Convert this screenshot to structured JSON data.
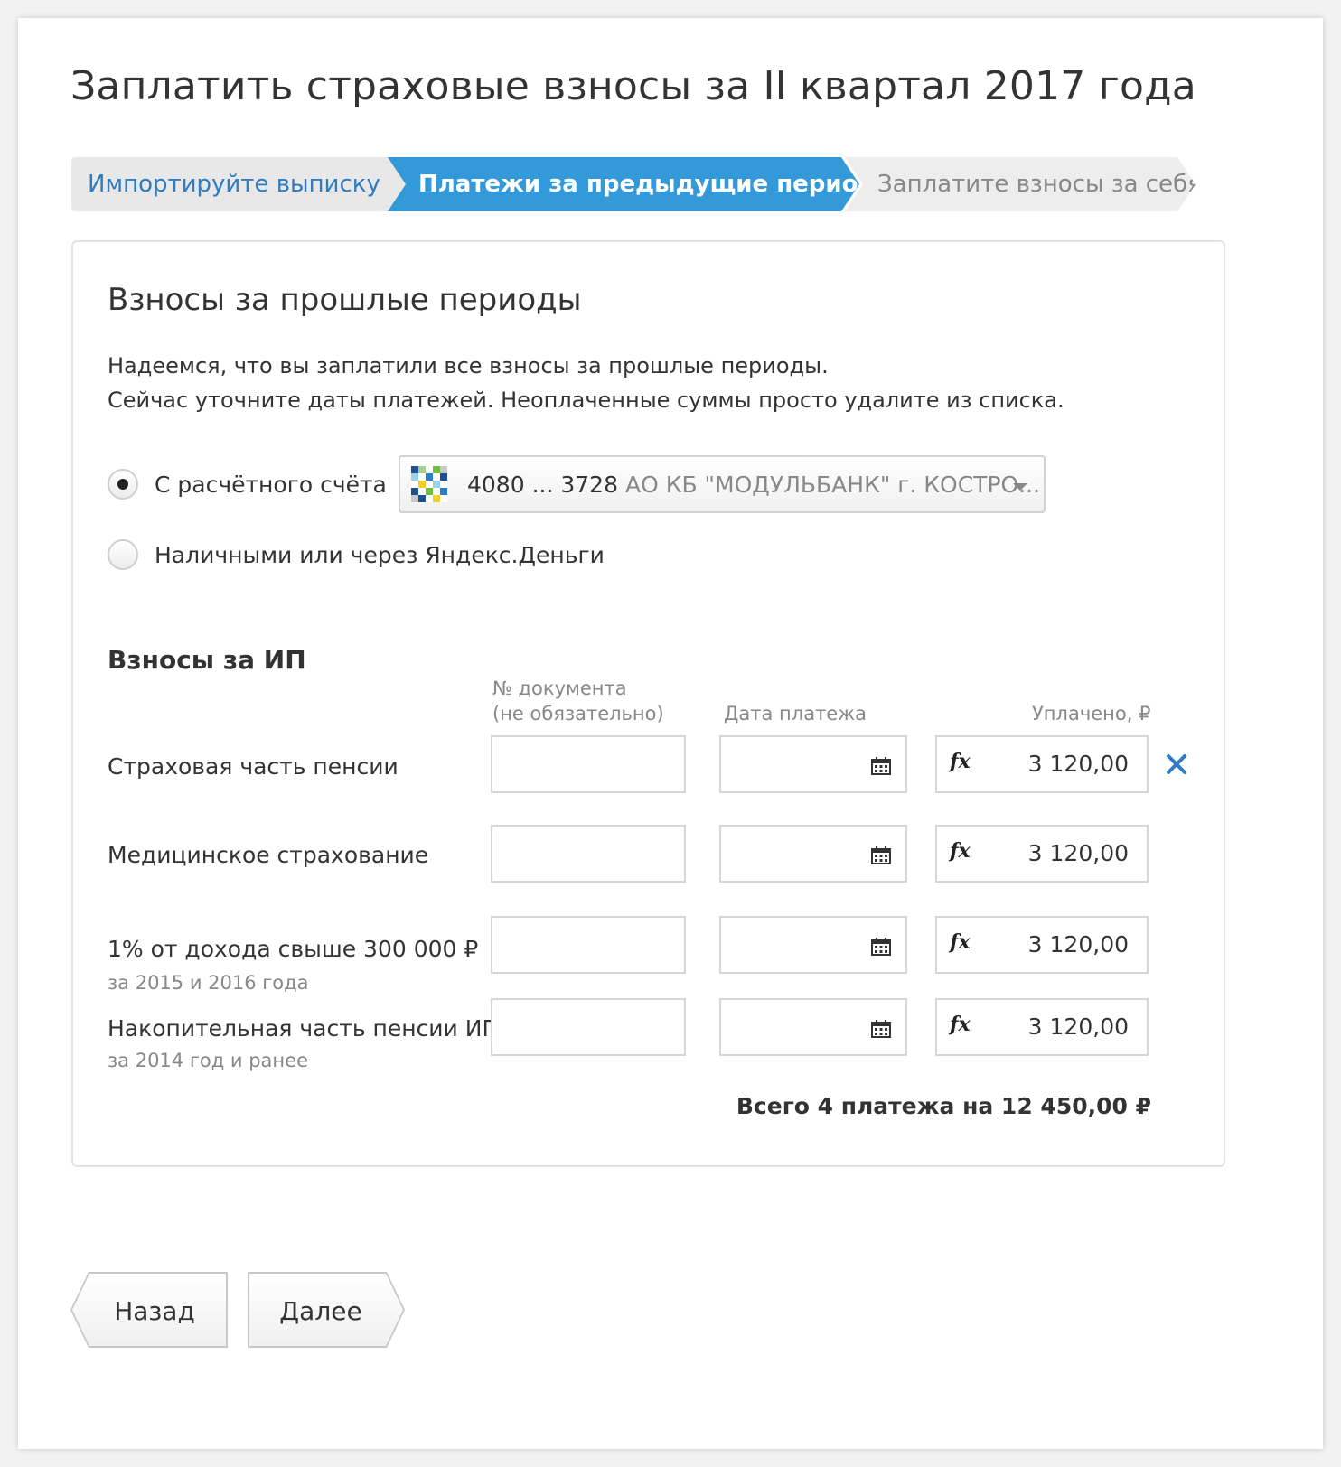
{
  "page": {
    "title": "Заплатить страховые взносы за II квартал 2017 года"
  },
  "stepper": {
    "steps": [
      {
        "label": "Импортируйте выписку",
        "state": "done"
      },
      {
        "label": "Платежи за предыдущие периоды",
        "state": "active"
      },
      {
        "label": "Заплатите взносы за себя",
        "state": "pending"
      }
    ]
  },
  "card": {
    "title": "Взносы за прошлые периоды",
    "description": [
      "Надеемся, что вы заплатили все взносы за прошлые периоды.",
      "Сейчас уточните даты платежей. Неоплаченные суммы просто удалите из списка."
    ],
    "payment_source": {
      "options": [
        {
          "label": "С расчётного счёта",
          "checked": true
        },
        {
          "label": "Наличными или через Яндекс.Деньги",
          "checked": false
        }
      ],
      "account": {
        "number": "4080 ... 3728",
        "bank": "АО КБ \"МОДУЛЬБАНК\" г. КОСТРО..."
      }
    },
    "contributions": {
      "title": "Взносы за ИП",
      "columns": {
        "doc_line1": "№ документа",
        "doc_line2": "(не обязательно)",
        "date": "Дата платежа",
        "paid": "Уплачено, ₽"
      },
      "rows": [
        {
          "label": "Страховая часть пенсии",
          "sublabel": "",
          "doc": "",
          "date": "",
          "sum": "3 120,00",
          "removable": true
        },
        {
          "label": "Медицинское страхование",
          "sublabel": "",
          "doc": "",
          "date": "",
          "sum": "3 120,00",
          "removable": false
        },
        {
          "label": "1% от дохода свыше 300 000 ₽",
          "sublabel": "за 2015 и 2016 года",
          "doc": "",
          "date": "",
          "sum": "3 120,00",
          "removable": false
        },
        {
          "label": "Накопительная часть пенсии ИП",
          "sublabel": "за 2014 год и ранее",
          "doc": "",
          "date": "",
          "sum": "3 120,00",
          "removable": false
        }
      ],
      "total": "Всего 4 платежа на 12 450,00 ₽"
    }
  },
  "actions": {
    "back": "Назад",
    "next": "Далее"
  },
  "icons": {
    "calendar": "calendar-icon",
    "formula": "fx-icon",
    "remove": "close-icon",
    "dropdown": "chevron-down-icon"
  },
  "colors": {
    "accent": "#3399d8",
    "link": "#2f7cc3",
    "remove": "#2f7cc3"
  }
}
